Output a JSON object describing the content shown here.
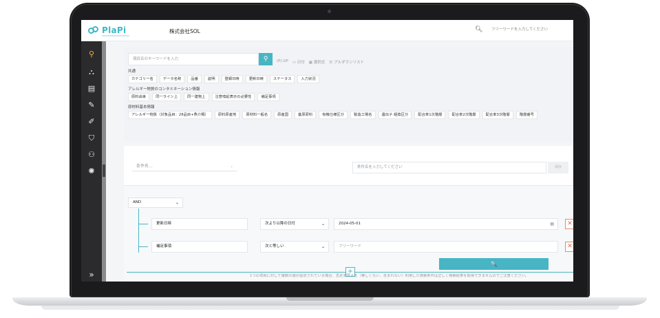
{
  "header": {
    "logo_text": "PlaPi",
    "company": "株式会社SOL",
    "search_placeholder": "フリーワードを入力してください"
  },
  "sidebar": {
    "icons": [
      "search-icon",
      "hierarchy-icon",
      "document-icon",
      "edit-icon",
      "pipette-icon",
      "shield-icon",
      "users-icon",
      "lightbulb-icon"
    ],
    "expand_label": "»"
  },
  "keyword": {
    "placeholder": "項目名のキーワードを入力",
    "legend": [
      "(P):UP",
      "日付",
      "選択式",
      "プルダウンリスト"
    ]
  },
  "sections": [
    {
      "label": "共通",
      "chips": [
        "カテゴリー名",
        "データ名称",
        "品番",
        "説明",
        "登録日時",
        "更新日時",
        "ステータス",
        "入力状況"
      ]
    },
    {
      "label": "アレルギー物質のコンタミネーション情報",
      "chips": [
        "原料由来",
        "同一ライン上",
        "同一建物上",
        "注意喚起表示の必要性",
        "補足事項"
      ]
    },
    {
      "label": "原材料基本情報",
      "chips": [
        "アレルギー物質（対象品目：28品目+魚介類）",
        "原料原産地",
        "原材料一般名",
        "原産国",
        "基原原料",
        "有機仕様区分",
        "製造工場名",
        "遺伝子 組換区分",
        "配合率1次階層",
        "配合率2次階層",
        "配合率3次階層",
        "階層番号"
      ]
    }
  ],
  "condition": {
    "name_placeholder": "条件名...",
    "value_placeholder": "条件名を入力してください",
    "save_label": "保存"
  },
  "query": {
    "operator": "AND",
    "rows": [
      {
        "field": "更新日時",
        "op": "次より以降の日付",
        "value": "2024-05-01",
        "is_placeholder": false
      },
      {
        "field": "補足事項",
        "op": "次と等しい",
        "value": "フリーワード",
        "is_placeholder": true
      }
    ],
    "add_label": "+",
    "search_label": "🔍",
    "note": "1つの項目に対して複数の値が設定されている場合、否定演算子を（等しくない、含まれない）利用した検索条件は正しく検索結果を取得できませんのでご注意ください。"
  },
  "colors": {
    "accent": "#47b5c3",
    "sidebar": "#2b2b2d",
    "active_icon": "#f2b233",
    "delete": "#e36b4b"
  }
}
